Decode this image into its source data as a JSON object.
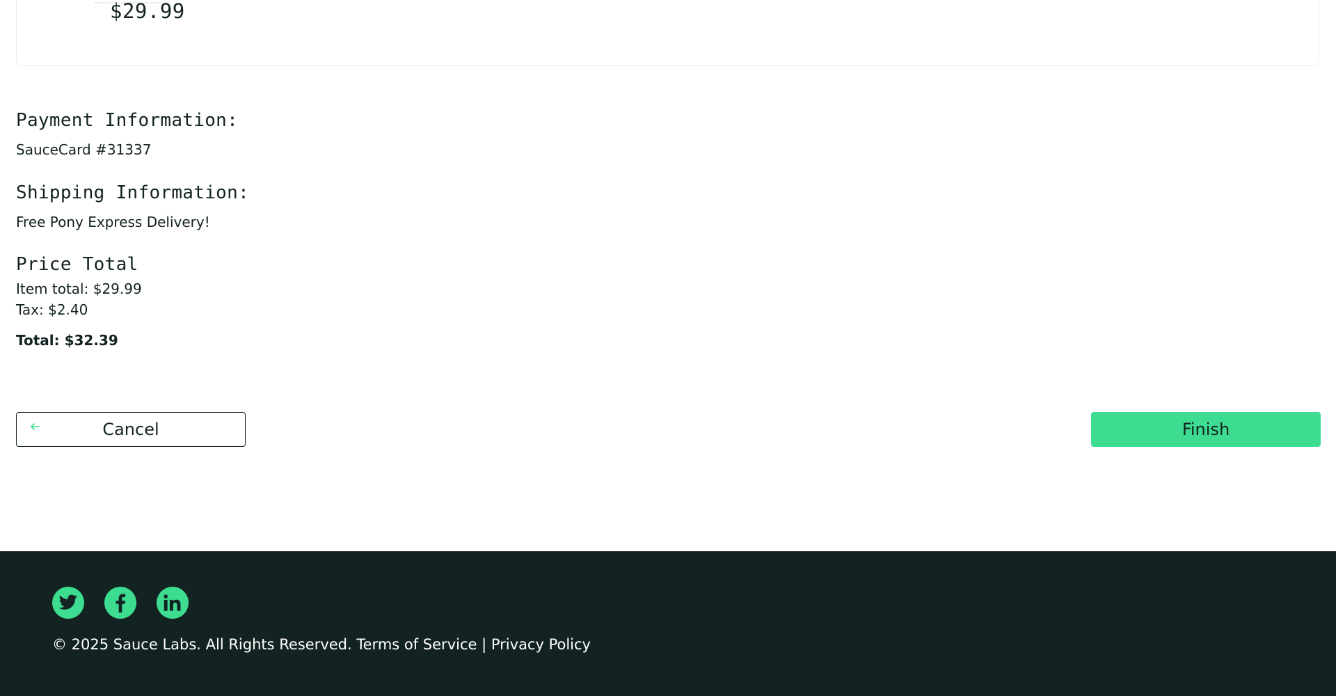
{
  "cart_item": {
    "price": "$29.99"
  },
  "summary": {
    "payment_label": "Payment Information:",
    "payment_value": "SauceCard #31337",
    "shipping_label": "Shipping Information:",
    "shipping_value": "Free Pony Express Delivery!",
    "price_total_label": "Price Total",
    "item_total": "Item total: $29.99",
    "tax": "Tax: $2.40",
    "total": "Total: $32.39"
  },
  "buttons": {
    "cancel_label": "Cancel",
    "finish_label": "Finish"
  },
  "footer": {
    "social_icons": [
      "twitter-icon",
      "facebook-icon",
      "linkedin-icon"
    ],
    "copyright": "© 2025 Sauce Labs. All Rights Reserved.",
    "terms": "Terms of Service",
    "separator": "|",
    "privacy": "Privacy Policy"
  },
  "colors": {
    "accent": "#3ddc91",
    "dark": "#132322",
    "border": "#ededed"
  }
}
